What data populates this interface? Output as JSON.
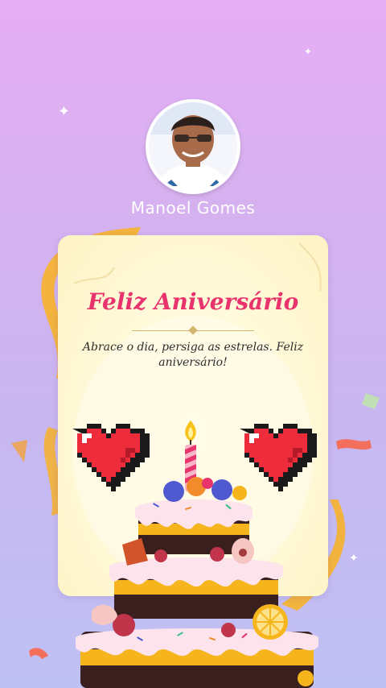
{
  "profile": {
    "name": "Manoel Gomes"
  },
  "card": {
    "title": "Feliz Aniversário",
    "message": "Abrace o dia, persiga as estrelas. Feliz aniversário!"
  },
  "colors": {
    "background_top": "#e6aef5",
    "background_bottom": "#bfc1f3",
    "title": "#e8336d",
    "card": "#fff9d8",
    "heart": "#ef2c3c",
    "ribbon": "#f7b22a"
  },
  "icons": {
    "hearts": [
      "pixel-heart-icon",
      "pixel-heart-icon"
    ],
    "candle": "candle-icon",
    "cake": "birthday-cake-icon",
    "sparkles": "sparkle-icon"
  }
}
